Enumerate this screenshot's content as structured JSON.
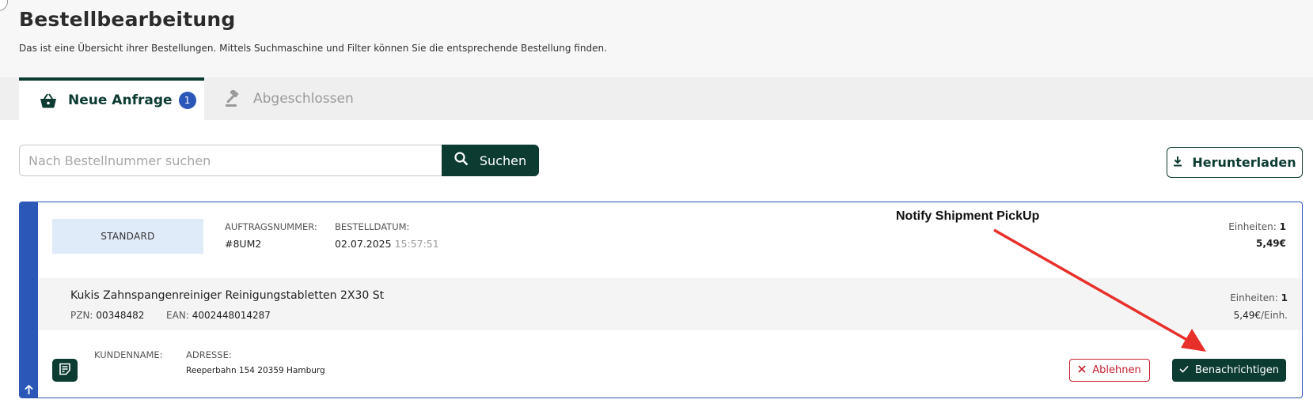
{
  "header": {
    "title": "Bestellbearbeitung",
    "description": "Das ist eine Übersicht ihrer Bestellungen. Mittels Suchmaschine und Filter können Sie die entsprechende Bestellung finden."
  },
  "tabs": {
    "active": {
      "label": "Neue Anfrage",
      "count": "1",
      "icon": "basket-icon"
    },
    "inactive": {
      "label": "Abgeschlossen",
      "icon": "gavel-icon"
    }
  },
  "search": {
    "placeholder": "Nach Bestellnummer suchen",
    "value": "",
    "button_label": "Suchen"
  },
  "download_label": "Herunterladen",
  "order": {
    "type": "STANDARD",
    "order_number_label": "AUFTRAGSNUMMER:",
    "order_number": "#8UM2",
    "order_date_label": "BESTELLDATUM:",
    "order_date": "02.07.2025",
    "order_time": "15:57:51",
    "units_label": "Einheiten:",
    "units": "1",
    "total": "5,49€",
    "product": {
      "name": "Kukis Zahnspangenreiniger Reinigungstabletten 2X30 St",
      "pzn_label": "PZN:",
      "pzn": "00348482",
      "ean_label": "EAN:",
      "ean": "4002448014287",
      "units_label": "Einheiten:",
      "units": "1",
      "unit_price": "5,49€",
      "unit_suffix": "/Einh."
    },
    "customer_label": "KUNDENNAME:",
    "customer_name": "",
    "address_label": "ADRESSE:",
    "address": "Reeperbahn 154 20359 Hamburg",
    "reject_label": "Ablehnen",
    "notify_label": "Benachrichtigen"
  },
  "annotation": {
    "text": "Notify Shipment PickUp",
    "color": "#e8302a"
  },
  "colors": {
    "primary": "#0c3b32",
    "accent_blue": "#2a57b8",
    "danger": "#c7202f"
  }
}
